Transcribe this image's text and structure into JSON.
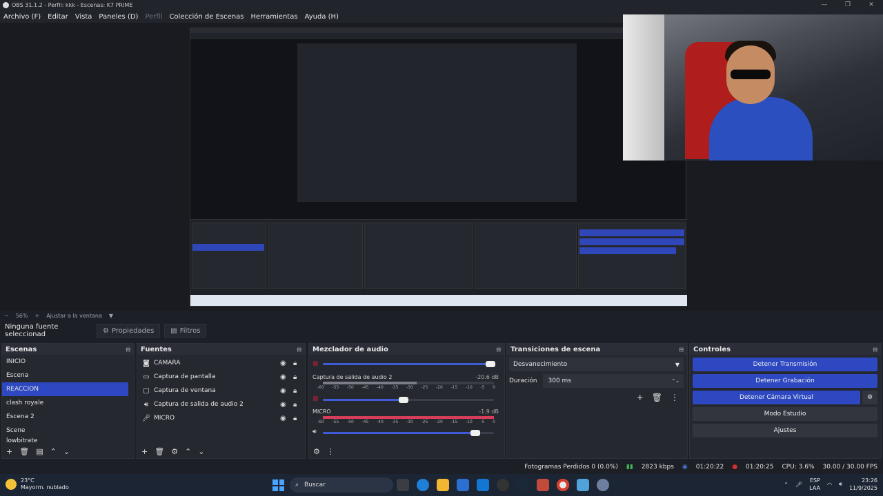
{
  "window": {
    "title": "OBS 31.1.2 - Perfil: kkk - Escenas: K7 PRIME",
    "min": "—",
    "max": "❐",
    "close": "✕"
  },
  "menu": [
    "Archivo (F)",
    "Editar",
    "Vista",
    "Paneles (D)",
    "Perfil",
    "Colección de Escenas",
    "Herramientas",
    "Ayuda (H)"
  ],
  "zoom": {
    "minus": "−",
    "level": "56%",
    "plus": "+",
    "fit": "Ajustar a la ventana",
    "caret": "▼"
  },
  "context": {
    "no_source": "Ninguna fuente seleccionad",
    "properties": "Propiedades",
    "filters": "Filtros"
  },
  "scenes": {
    "title": "Escenas",
    "items": [
      "INICIO",
      "Escena",
      "REACCION",
      "clash royale",
      "Escena 2",
      "Scene",
      "lowbitrate"
    ],
    "selected": "REACCION"
  },
  "sources": {
    "title": "Fuentes",
    "items": [
      {
        "name": "CAMARA",
        "icon": "camera-icon"
      },
      {
        "name": "Captura de pantalla",
        "icon": "monitor-icon"
      },
      {
        "name": "Captura de ventana",
        "icon": "window-icon"
      },
      {
        "name": "Captura de salida de audio 2",
        "icon": "speaker-icon"
      },
      {
        "name": "MICRO",
        "icon": "microphone-icon"
      }
    ]
  },
  "mixer": {
    "title": "Mezclador de audio",
    "channels": [
      {
        "name": "",
        "db": "",
        "fader": 1.0
      },
      {
        "name": "Captura de salida de audio 2",
        "db": "-20.6 dB",
        "fader": 0.47
      },
      {
        "name": "MICRO",
        "db": "-1.9 dB",
        "fader": 0.88
      }
    ],
    "scale": [
      "-60",
      "-55",
      "-50",
      "-45",
      "-40",
      "-35",
      "-30",
      "-25",
      "-20",
      "-15",
      "-10",
      "-5",
      "0"
    ]
  },
  "transitions": {
    "title": "Transiciones de escena",
    "selected": "Desvanecimiento",
    "duration_label": "Duración",
    "duration": "300 ms"
  },
  "controls": {
    "title": "Controles",
    "buttons": [
      "Detener Transmisión",
      "Detener Grabación",
      "Detener Cámara Virtual",
      "Modo Estudio",
      "Ajustes"
    ]
  },
  "status": {
    "frames": "Fotogramas Perdidos 0 (0.0%)",
    "bitrate": "2823 kbps",
    "stream_time": "01:20:22",
    "rec_time": "01:20:25",
    "cpu": "CPU: 3.6%",
    "fps": "30.00 / 30.00 FPS"
  },
  "taskbar": {
    "temp": "23°C",
    "weather": "Mayorm. nublado",
    "search": "Buscar",
    "lang1": "ESP",
    "lang2": "LAA",
    "time": "23:26",
    "date": "11/9/2025"
  },
  "colors": {
    "accent": "#2d48c0",
    "meter_green": "#3a9a45",
    "meter_red": "#d63d5a",
    "status_green": "#3fb34f"
  }
}
